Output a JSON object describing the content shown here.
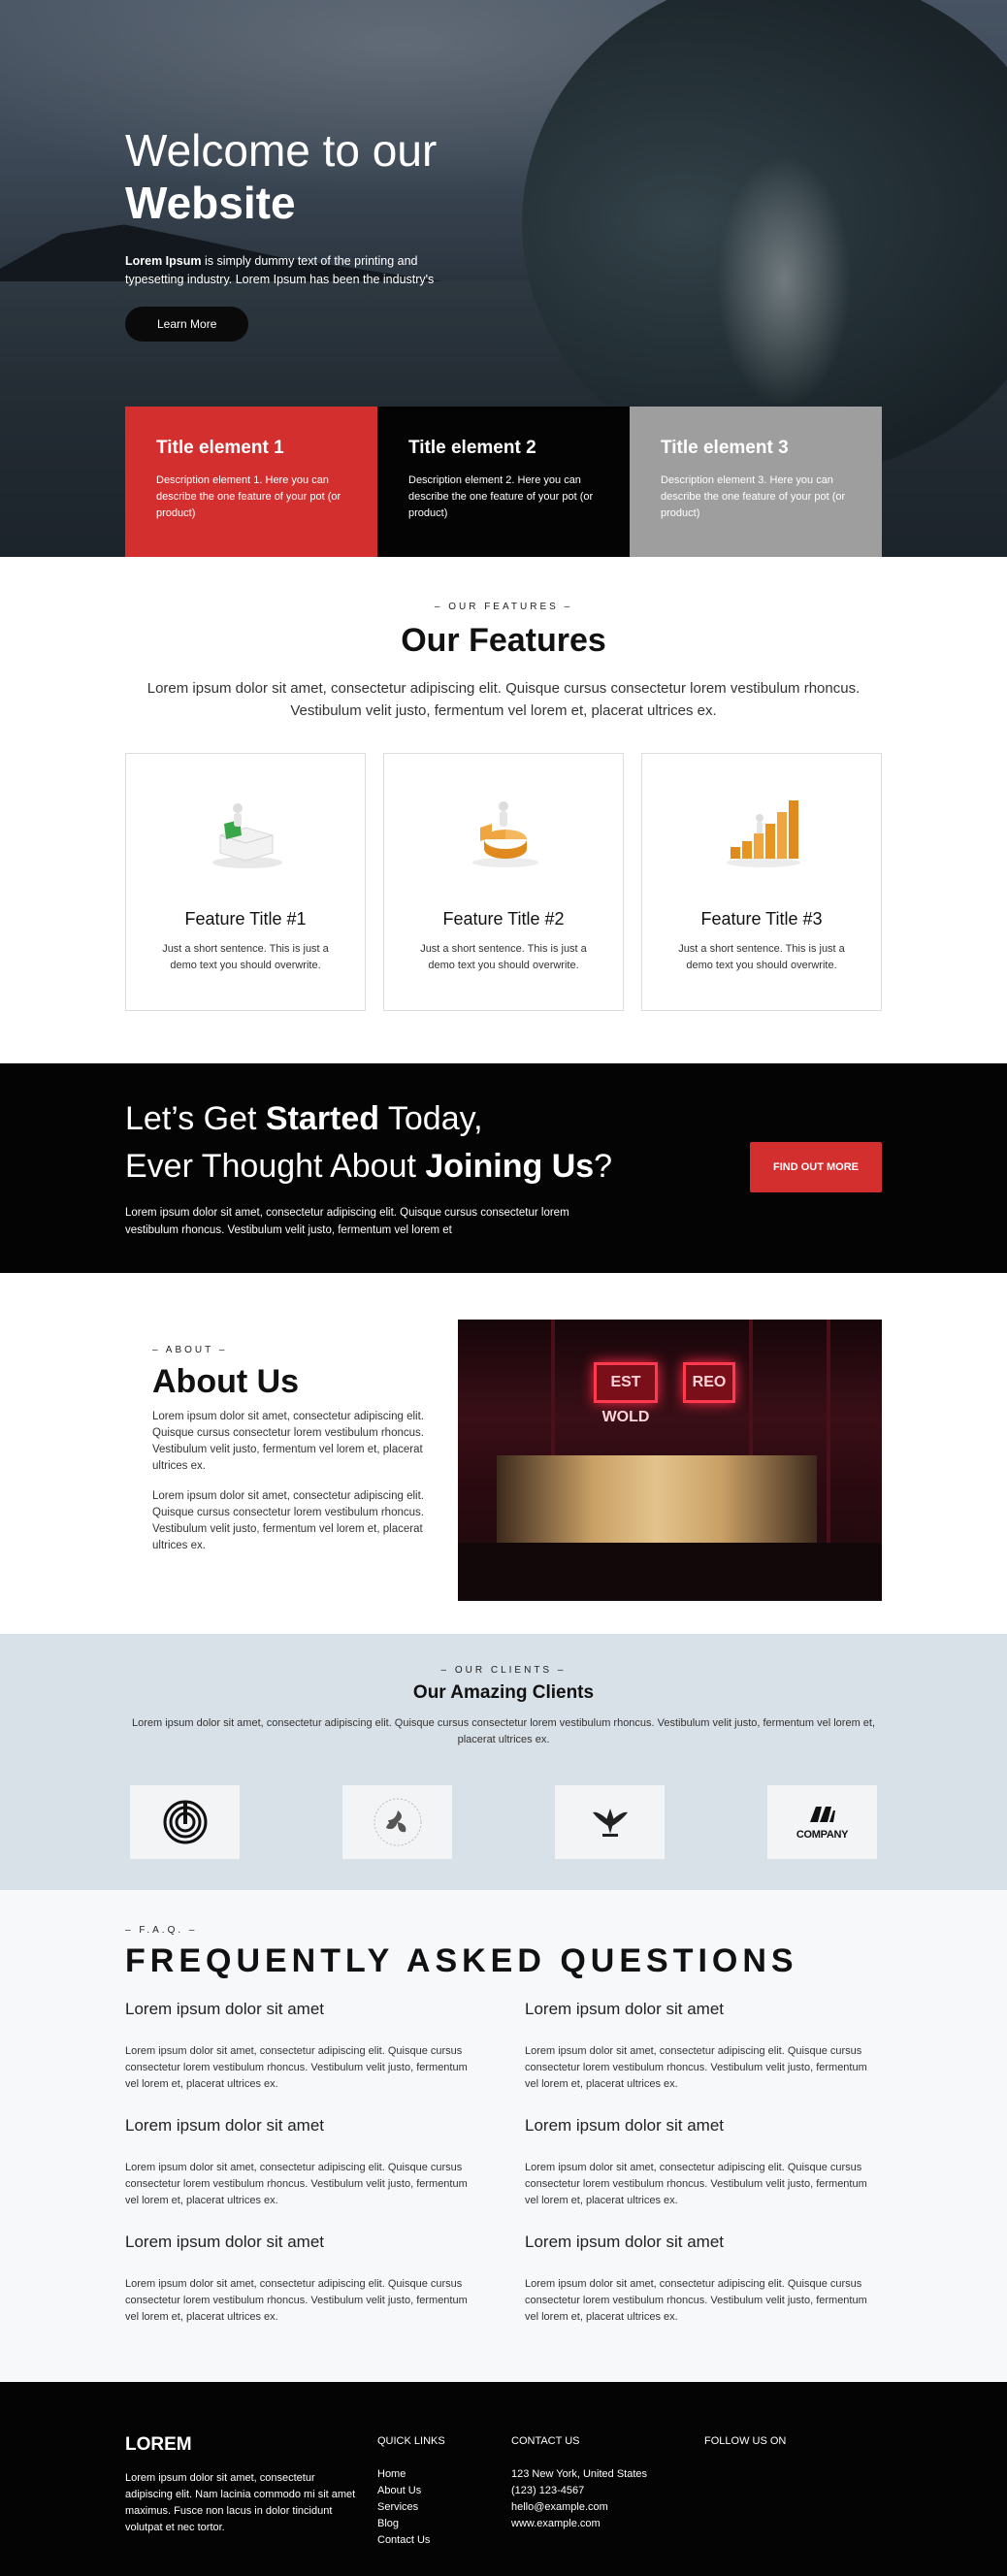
{
  "hero": {
    "title_line1": "Welcome to our",
    "title_line2": "Website",
    "desc_bold": "Lorem Ipsum",
    "desc_rest": " is simply dummy text of the printing and typesetting industry. Lorem Ipsum has been the industry's",
    "button": "Learn More"
  },
  "title_elements": [
    {
      "title": "Title element 1",
      "desc": "Description element 1. Here you can describe the one feature of your pot (or product)",
      "color": "#d32f2f"
    },
    {
      "title": "Title element 2",
      "desc": "Description element 2. Here you can describe the one feature of your pot (or product)",
      "color": "#040404"
    },
    {
      "title": "Title element 3",
      "desc": "Description element 3. Here you can describe the one feature of your pot (or product)",
      "color": "#9e9e9e"
    }
  ],
  "features": {
    "eyebrow": "– OUR FEATURES –",
    "title": "Our Features",
    "lead": "Lorem ipsum dolor sit amet, consectetur adipiscing elit. Quisque cursus consectetur lorem vestibulum rhoncus. Vestibulum velit justo, fermentum vel lorem et, placerat ultrices ex.",
    "cards": [
      {
        "title": "Feature Title #1",
        "text": "Just a short sentence. This is just a demo text you should overwrite.",
        "icon": "puzzle-figure-icon"
      },
      {
        "title": "Feature Title #2",
        "text": "Just a short sentence. This is just a demo text you should overwrite.",
        "icon": "pie-chart-figure-icon"
      },
      {
        "title": "Feature Title #3",
        "text": "Just a short sentence. This is just a demo text you should overwrite.",
        "icon": "bar-chart-stairs-icon"
      }
    ]
  },
  "cta": {
    "line1_light": "Let’s Get ",
    "line1_bold": "Started",
    "line1_end": " Today,",
    "line2_light": "Ever Thought About ",
    "line2_bold": "Joining Us",
    "line2_end": "?",
    "text": "Lorem ipsum dolor sit amet, consectetur adipiscing elit. Quisque cursus consectetur lorem vestibulum rhoncus. Vestibulum velit justo, fermentum vel lorem et",
    "button": "FIND OUT MORE",
    "accent": "#d32f2f"
  },
  "about": {
    "eyebrow": "– ABOUT –",
    "title": "About Us",
    "p1": "Lorem ipsum dolor sit amet, consectetur adipiscing elit. Quisque cursus consectetur lorem vestibulum rhoncus. Vestibulum velit justo, fermentum vel lorem et, placerat ultrices ex.",
    "p2": "Lorem ipsum dolor sit amet, consectetur adipiscing elit. Quisque cursus consectetur lorem vestibulum rhoncus. Vestibulum velit justo, fermentum vel lorem et, placerat ultrices ex.",
    "sign1": "EST WOLD",
    "sign2": "REO"
  },
  "clients": {
    "eyebrow": "– OUR CLIENTS –",
    "title": "Our Amazing Clients",
    "lead": "Lorem ipsum dolor sit amet, consectetur adipiscing elit. Quisque cursus consectetur lorem vestibulum rhoncus. Vestibulum velit justo, fermentum vel lorem et, placerat ultrices ex.",
    "logo4_text": "COMPANY"
  },
  "faq": {
    "eyebrow": "– F.A.Q. –",
    "title": "FREQUENTLY ASKED QUESTIONS",
    "items": [
      {
        "q": "Lorem ipsum dolor sit amet",
        "a": "Lorem ipsum dolor sit amet, consectetur adipiscing elit. Quisque cursus consectetur lorem vestibulum rhoncus. Vestibulum velit justo, fermentum vel lorem et, placerat ultrices ex."
      },
      {
        "q": "Lorem ipsum dolor sit amet",
        "a": "Lorem ipsum dolor sit amet, consectetur adipiscing elit. Quisque cursus consectetur lorem vestibulum rhoncus. Vestibulum velit justo, fermentum vel lorem et, placerat ultrices ex."
      },
      {
        "q": "Lorem ipsum dolor sit amet",
        "a": "Lorem ipsum dolor sit amet, consectetur adipiscing elit. Quisque cursus consectetur lorem vestibulum rhoncus. Vestibulum velit justo, fermentum vel lorem et, placerat ultrices ex."
      },
      {
        "q": "Lorem ipsum dolor sit amet",
        "a": "Lorem ipsum dolor sit amet, consectetur adipiscing elit. Quisque cursus consectetur lorem vestibulum rhoncus. Vestibulum velit justo, fermentum vel lorem et, placerat ultrices ex."
      },
      {
        "q": "Lorem ipsum dolor sit amet",
        "a": "Lorem ipsum dolor sit amet, consectetur adipiscing elit. Quisque cursus consectetur lorem vestibulum rhoncus. Vestibulum velit justo, fermentum vel lorem et, placerat ultrices ex."
      },
      {
        "q": "Lorem ipsum dolor sit amet",
        "a": "Lorem ipsum dolor sit amet, consectetur adipiscing elit. Quisque cursus consectetur lorem vestibulum rhoncus. Vestibulum velit justo, fermentum vel lorem et, placerat ultrices ex."
      }
    ]
  },
  "footer": {
    "brand": "LOREM",
    "brand_text": "Lorem ipsum dolor sit amet, consectetur adipiscing elit. Nam lacinia commodo mi sit amet maximus. Fusce non lacus in dolor tincidunt volutpat et nec tortor.",
    "quick_links_title": "QUICK LINKS",
    "quick_links": [
      "Home",
      "About Us",
      "Services",
      "Blog",
      "Contact Us"
    ],
    "contact_title": "CONTACT US",
    "contact": [
      "123 New York, United States",
      "(123) 123-4567",
      "hello@example.com",
      "www.example.com"
    ],
    "follow_title": "FOLLOW US ON"
  }
}
